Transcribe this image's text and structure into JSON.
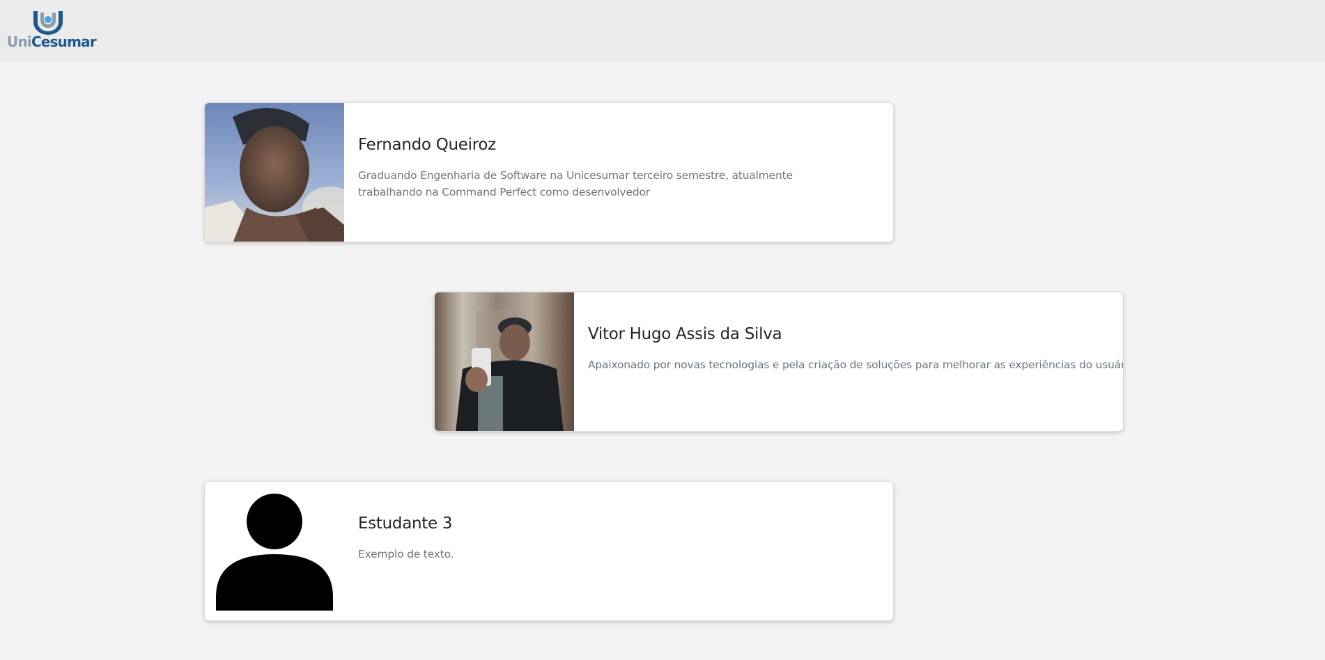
{
  "header": {
    "logo": {
      "icon": "unicesumar-logo-mark",
      "text_part1": "Uni",
      "text_part2": "Cesumar",
      "colors": {
        "uni": "#8a9bab",
        "cesumar": "#1d5a8c",
        "mark_blue": "#1d5a8c",
        "mark_light": "#4fa3d9"
      }
    },
    "background": "#ebebeb"
  },
  "page": {
    "background": "#f3f3f3"
  },
  "students": [
    {
      "name": "Fernando Queiroz",
      "description": "Graduando Engenharia de Software na Unicesumar terceiro semestre, atualmente trabalhando na Command Perfect como desenvolvedor",
      "photo": "profile-photo-selfie-outdoor"
    },
    {
      "name": "Vitor Hugo Assis da Silva",
      "description": "Apaixonado por novas tecnologias e pela criação de soluções para melhorar as experiências do usuário.",
      "photo": "profile-photo-elevator-mirror-selfie"
    },
    {
      "name": "Estudante 3",
      "description": "Exemplo de texto.",
      "photo": "person-placeholder-icon"
    }
  ]
}
